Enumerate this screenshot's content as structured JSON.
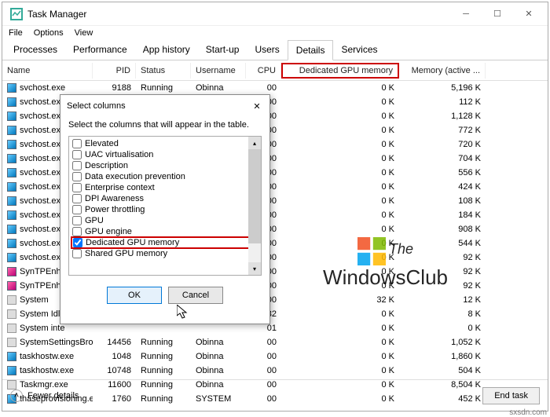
{
  "window": {
    "title": "Task Manager"
  },
  "menu": [
    "File",
    "Options",
    "View"
  ],
  "tabs": [
    "Processes",
    "Performance",
    "App history",
    "Start-up",
    "Users",
    "Details",
    "Services"
  ],
  "activeTab": "Details",
  "columns": {
    "name": "Name",
    "pid": "PID",
    "status": "Status",
    "user": "Username",
    "cpu": "CPU",
    "gpu": "Dedicated GPU memory",
    "mem": "Memory (active ..."
  },
  "rows": [
    {
      "name": "svchost.exe",
      "pid": "9188",
      "status": "Running",
      "user": "Obinna",
      "cpu": "00",
      "gpu": "0 K",
      "mem": "5,196 K",
      "icon": "blue"
    },
    {
      "name": "svchost.exe",
      "pid": "",
      "status": "",
      "user": "",
      "cpu": "00",
      "gpu": "0 K",
      "mem": "112 K",
      "icon": "blue"
    },
    {
      "name": "svchost.exe",
      "pid": "",
      "status": "",
      "user": "",
      "cpu": "00",
      "gpu": "0 K",
      "mem": "1,128 K",
      "icon": "blue"
    },
    {
      "name": "svchost.exe",
      "pid": "",
      "status": "",
      "user": "",
      "cpu": "00",
      "gpu": "0 K",
      "mem": "772 K",
      "icon": "blue"
    },
    {
      "name": "svchost.exe",
      "pid": "",
      "status": "",
      "user": "",
      "cpu": "00",
      "gpu": "0 K",
      "mem": "720 K",
      "icon": "blue"
    },
    {
      "name": "svchost.exe",
      "pid": "",
      "status": "",
      "user": "",
      "cpu": "00",
      "gpu": "0 K",
      "mem": "704 K",
      "icon": "blue"
    },
    {
      "name": "svchost.exe",
      "pid": "",
      "status": "",
      "user": "",
      "cpu": "00",
      "gpu": "0 K",
      "mem": "556 K",
      "icon": "blue"
    },
    {
      "name": "svchost.exe",
      "pid": "",
      "status": "",
      "user": "",
      "cpu": "00",
      "gpu": "0 K",
      "mem": "424 K",
      "icon": "blue"
    },
    {
      "name": "svchost.exe",
      "pid": "",
      "status": "",
      "user": "",
      "cpu": "00",
      "gpu": "0 K",
      "mem": "108 K",
      "icon": "blue"
    },
    {
      "name": "svchost.exe",
      "pid": "",
      "status": "",
      "user": "",
      "cpu": "00",
      "gpu": "0 K",
      "mem": "184 K",
      "icon": "blue"
    },
    {
      "name": "svchost.exe",
      "pid": "",
      "status": "",
      "user": "",
      "cpu": "00",
      "gpu": "0 K",
      "mem": "908 K",
      "icon": "blue"
    },
    {
      "name": "svchost.exe",
      "pid": "",
      "status": "",
      "user": "",
      "cpu": "00",
      "gpu": "0 K",
      "mem": "544 K",
      "icon": "blue"
    },
    {
      "name": "svchost.exe",
      "pid": "",
      "status": "",
      "user": "",
      "cpu": "00",
      "gpu": "0 K",
      "mem": "92 K",
      "icon": "blue"
    },
    {
      "name": "SynTPEnh.e...",
      "pid": "",
      "status": "",
      "user": "",
      "cpu": "00",
      "gpu": "0 K",
      "mem": "92 K",
      "icon": "pink"
    },
    {
      "name": "SynTPEnh.e...",
      "pid": "",
      "status": "",
      "user": "",
      "cpu": "00",
      "gpu": "0 K",
      "mem": "92 K",
      "icon": "pink"
    },
    {
      "name": "System",
      "pid": "",
      "status": "",
      "user": "",
      "cpu": "00",
      "gpu": "32 K",
      "mem": "12 K",
      "icon": "sys"
    },
    {
      "name": "System Idle",
      "pid": "",
      "status": "",
      "user": "",
      "cpu": "82",
      "gpu": "0 K",
      "mem": "8 K",
      "icon": "sys"
    },
    {
      "name": "System inte",
      "pid": "",
      "status": "",
      "user": "",
      "cpu": "01",
      "gpu": "0 K",
      "mem": "0 K",
      "icon": "sys"
    },
    {
      "name": "SystemSettingsBroke...",
      "pid": "14456",
      "status": "Running",
      "user": "Obinna",
      "cpu": "00",
      "gpu": "0 K",
      "mem": "1,052 K",
      "icon": "sys"
    },
    {
      "name": "taskhostw.exe",
      "pid": "1048",
      "status": "Running",
      "user": "Obinna",
      "cpu": "00",
      "gpu": "0 K",
      "mem": "1,860 K",
      "icon": "blue"
    },
    {
      "name": "taskhostw.exe",
      "pid": "10748",
      "status": "Running",
      "user": "Obinna",
      "cpu": "00",
      "gpu": "0 K",
      "mem": "504 K",
      "icon": "blue"
    },
    {
      "name": "Taskmgr.exe",
      "pid": "11600",
      "status": "Running",
      "user": "Obinna",
      "cpu": "00",
      "gpu": "0 K",
      "mem": "8,504 K",
      "icon": "sys"
    },
    {
      "name": "thaseprovisioning.exe",
      "pid": "1760",
      "status": "Running",
      "user": "SYSTEM",
      "cpu": "00",
      "gpu": "0 K",
      "mem": "452 K",
      "icon": "blue"
    }
  ],
  "footer": {
    "fewer": "Fewer details",
    "endtask": "End task"
  },
  "dialog": {
    "title": "Select columns",
    "desc": "Select the columns that will appear in the table.",
    "items": [
      {
        "label": "Elevated",
        "checked": false
      },
      {
        "label": "UAC virtualisation",
        "checked": false
      },
      {
        "label": "Description",
        "checked": false
      },
      {
        "label": "Data execution prevention",
        "checked": false
      },
      {
        "label": "Enterprise context",
        "checked": false
      },
      {
        "label": "DPI Awareness",
        "checked": false
      },
      {
        "label": "Power throttling",
        "checked": false
      },
      {
        "label": "GPU",
        "checked": false
      },
      {
        "label": "GPU engine",
        "checked": false
      },
      {
        "label": "Dedicated GPU memory",
        "checked": true,
        "highlight": true
      },
      {
        "label": "Shared GPU memory",
        "checked": false
      }
    ],
    "ok": "OK",
    "cancel": "Cancel"
  },
  "watermark": {
    "the": "The",
    "wc": "WindowsClub"
  },
  "attrib": "sxsdn.com"
}
